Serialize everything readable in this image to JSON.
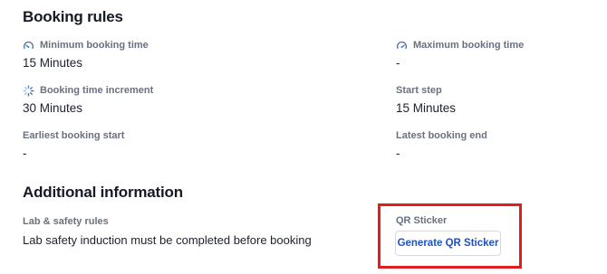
{
  "booking_rules": {
    "title": "Booking rules",
    "minimum_booking_time": {
      "label": "Minimum booking time",
      "value": "15 Minutes",
      "icon": "gauge-low-icon"
    },
    "maximum_booking_time": {
      "label": "Maximum booking time",
      "value": "-",
      "icon": "gauge-high-icon"
    },
    "booking_time_increment": {
      "label": "Booking time increment",
      "value": "30 Minutes",
      "icon": "spinner-icon"
    },
    "start_step": {
      "label": "Start step",
      "value": "15 Minutes"
    },
    "earliest_booking_start": {
      "label": "Earliest booking start",
      "value": "-"
    },
    "latest_booking_end": {
      "label": "Latest booking end",
      "value": "-"
    }
  },
  "additional_information": {
    "title": "Additional information",
    "lab_safety_rules": {
      "label": "Lab & safety rules",
      "value": "Lab safety induction must be completed before booking"
    },
    "qr_sticker": {
      "label": "QR Sticker",
      "button_label": "Generate QR Sticker"
    }
  },
  "colors": {
    "accent": "#1f4fc6",
    "highlight_border": "#e11d1d",
    "label_text": "#6b7080",
    "value_text": "#1c2030"
  }
}
